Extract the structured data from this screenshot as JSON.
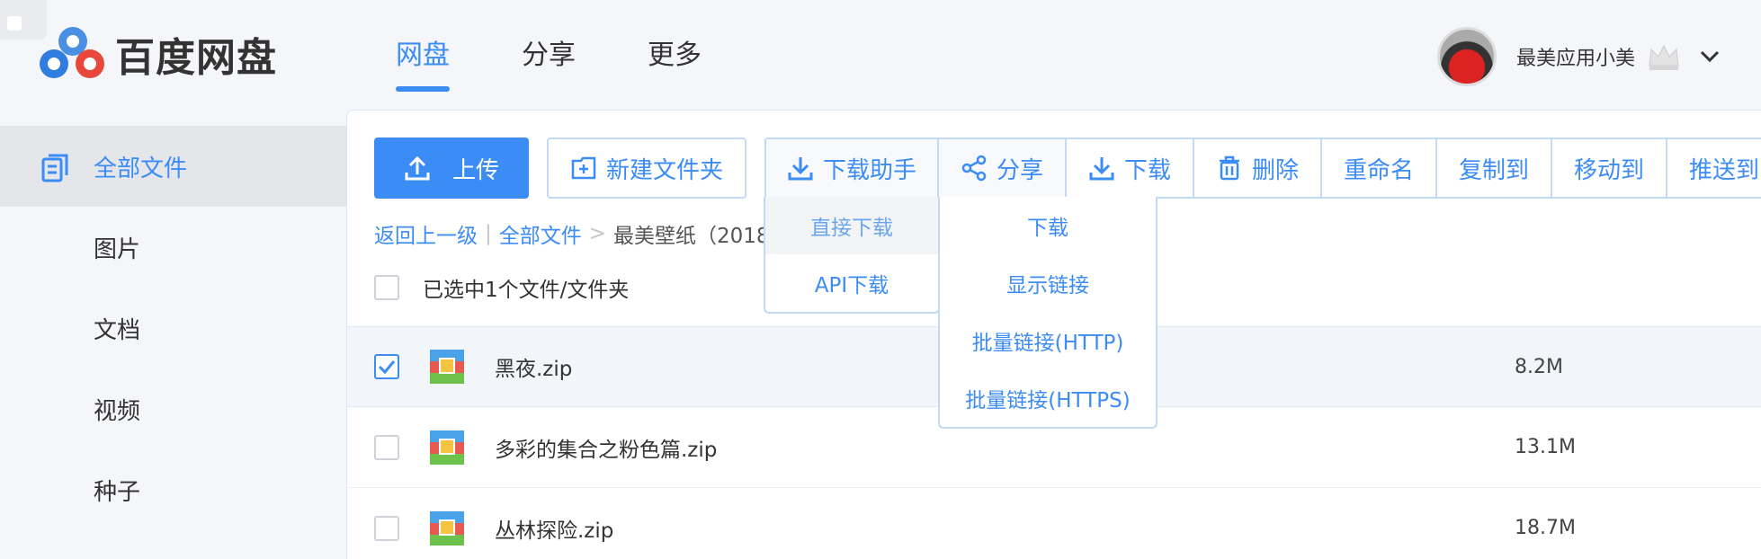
{
  "app": {
    "title": "百度网盘"
  },
  "nav": {
    "items": [
      "网盘",
      "分享",
      "更多"
    ]
  },
  "user": {
    "name": "最美应用小美"
  },
  "sidebar": {
    "items": [
      "全部文件",
      "图片",
      "文档",
      "视频",
      "种子"
    ]
  },
  "toolbar": {
    "upload": "上传",
    "new_folder": "新建文件夹",
    "download_helper": "下载助手",
    "share": "分享",
    "download": "下载",
    "delete": "删除",
    "rename": "重命名",
    "copy_to": "复制到",
    "move_to": "移动到",
    "push_to": "推送到"
  },
  "helper_menu": {
    "items": [
      "直接下载",
      "API下载"
    ]
  },
  "download_menu": {
    "items": [
      "下载",
      "显示链接",
      "批量链接(HTTP)",
      "批量链接(HTTPS)"
    ]
  },
  "breadcrumb": {
    "back": "返回上一级",
    "sep1": "|",
    "root": "全部文件",
    "sep2": ">",
    "current": "最美壁纸（2018"
  },
  "selection": {
    "text": "已选中1个文件/文件夹"
  },
  "files": [
    {
      "name": "黑夜.zip",
      "size": "8.2M",
      "checked": true
    },
    {
      "name": "多彩的集合之粉色篇.zip",
      "size": "13.1M",
      "checked": false
    },
    {
      "name": "丛林探险.zip",
      "size": "18.7M",
      "checked": false
    }
  ],
  "colors": {
    "accent": "#3b8cf4",
    "border": "#c2daf6"
  }
}
